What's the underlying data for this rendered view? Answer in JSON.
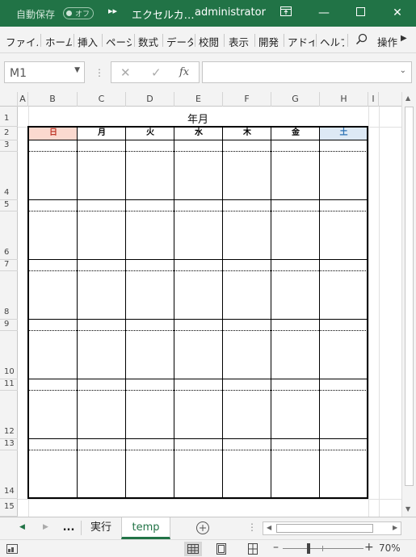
{
  "titlebar": {
    "autosave_label": "自動保存",
    "autosave_state": "オフ",
    "file_name": "エクセルカ…",
    "user_name": "administrator"
  },
  "ribbon": {
    "tabs": [
      "ファイル",
      "ホーム",
      "挿入",
      "ページ",
      "数式",
      "データ",
      "校閲",
      "表示",
      "開発",
      "アドイ",
      "ヘルプ"
    ],
    "operation_label": "操作"
  },
  "formula_bar": {
    "name_box": "M1",
    "formula_value": ""
  },
  "columns": [
    "A",
    "B",
    "C",
    "D",
    "E",
    "F",
    "G",
    "H",
    "I"
  ],
  "rows": [
    "1",
    "2",
    "3",
    "4",
    "5",
    "6",
    "7",
    "8",
    "9",
    "10",
    "11",
    "12",
    "13",
    "14",
    "15"
  ],
  "calendar": {
    "title": "年月",
    "days": [
      "日",
      "月",
      "火",
      "水",
      "木",
      "金",
      "土"
    ],
    "sunday_color": "#fbd9cf",
    "saturday_color": "#dde9f5",
    "sunday_text_color": "#c0392b",
    "saturday_text_color": "#2e74b5"
  },
  "sheet_tabs": {
    "ellipsis": "...",
    "tabs": [
      "実行",
      "temp"
    ],
    "active": "temp"
  },
  "status": {
    "zoom": "70%"
  },
  "colors": {
    "brand": "#217346"
  }
}
